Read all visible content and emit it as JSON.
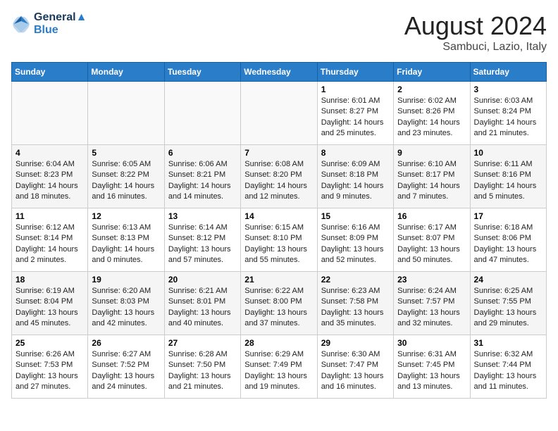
{
  "header": {
    "logo_line1": "General",
    "logo_line2": "Blue",
    "month": "August 2024",
    "location": "Sambuci, Lazio, Italy"
  },
  "weekdays": [
    "Sunday",
    "Monday",
    "Tuesday",
    "Wednesday",
    "Thursday",
    "Friday",
    "Saturday"
  ],
  "weeks": [
    [
      {
        "day": "",
        "info": ""
      },
      {
        "day": "",
        "info": ""
      },
      {
        "day": "",
        "info": ""
      },
      {
        "day": "",
        "info": ""
      },
      {
        "day": "1",
        "info": "Sunrise: 6:01 AM\nSunset: 8:27 PM\nDaylight: 14 hours\nand 25 minutes."
      },
      {
        "day": "2",
        "info": "Sunrise: 6:02 AM\nSunset: 8:26 PM\nDaylight: 14 hours\nand 23 minutes."
      },
      {
        "day": "3",
        "info": "Sunrise: 6:03 AM\nSunset: 8:24 PM\nDaylight: 14 hours\nand 21 minutes."
      }
    ],
    [
      {
        "day": "4",
        "info": "Sunrise: 6:04 AM\nSunset: 8:23 PM\nDaylight: 14 hours\nand 18 minutes."
      },
      {
        "day": "5",
        "info": "Sunrise: 6:05 AM\nSunset: 8:22 PM\nDaylight: 14 hours\nand 16 minutes."
      },
      {
        "day": "6",
        "info": "Sunrise: 6:06 AM\nSunset: 8:21 PM\nDaylight: 14 hours\nand 14 minutes."
      },
      {
        "day": "7",
        "info": "Sunrise: 6:08 AM\nSunset: 8:20 PM\nDaylight: 14 hours\nand 12 minutes."
      },
      {
        "day": "8",
        "info": "Sunrise: 6:09 AM\nSunset: 8:18 PM\nDaylight: 14 hours\nand 9 minutes."
      },
      {
        "day": "9",
        "info": "Sunrise: 6:10 AM\nSunset: 8:17 PM\nDaylight: 14 hours\nand 7 minutes."
      },
      {
        "day": "10",
        "info": "Sunrise: 6:11 AM\nSunset: 8:16 PM\nDaylight: 14 hours\nand 5 minutes."
      }
    ],
    [
      {
        "day": "11",
        "info": "Sunrise: 6:12 AM\nSunset: 8:14 PM\nDaylight: 14 hours\nand 2 minutes."
      },
      {
        "day": "12",
        "info": "Sunrise: 6:13 AM\nSunset: 8:13 PM\nDaylight: 14 hours\nand 0 minutes."
      },
      {
        "day": "13",
        "info": "Sunrise: 6:14 AM\nSunset: 8:12 PM\nDaylight: 13 hours\nand 57 minutes."
      },
      {
        "day": "14",
        "info": "Sunrise: 6:15 AM\nSunset: 8:10 PM\nDaylight: 13 hours\nand 55 minutes."
      },
      {
        "day": "15",
        "info": "Sunrise: 6:16 AM\nSunset: 8:09 PM\nDaylight: 13 hours\nand 52 minutes."
      },
      {
        "day": "16",
        "info": "Sunrise: 6:17 AM\nSunset: 8:07 PM\nDaylight: 13 hours\nand 50 minutes."
      },
      {
        "day": "17",
        "info": "Sunrise: 6:18 AM\nSunset: 8:06 PM\nDaylight: 13 hours\nand 47 minutes."
      }
    ],
    [
      {
        "day": "18",
        "info": "Sunrise: 6:19 AM\nSunset: 8:04 PM\nDaylight: 13 hours\nand 45 minutes."
      },
      {
        "day": "19",
        "info": "Sunrise: 6:20 AM\nSunset: 8:03 PM\nDaylight: 13 hours\nand 42 minutes."
      },
      {
        "day": "20",
        "info": "Sunrise: 6:21 AM\nSunset: 8:01 PM\nDaylight: 13 hours\nand 40 minutes."
      },
      {
        "day": "21",
        "info": "Sunrise: 6:22 AM\nSunset: 8:00 PM\nDaylight: 13 hours\nand 37 minutes."
      },
      {
        "day": "22",
        "info": "Sunrise: 6:23 AM\nSunset: 7:58 PM\nDaylight: 13 hours\nand 35 minutes."
      },
      {
        "day": "23",
        "info": "Sunrise: 6:24 AM\nSunset: 7:57 PM\nDaylight: 13 hours\nand 32 minutes."
      },
      {
        "day": "24",
        "info": "Sunrise: 6:25 AM\nSunset: 7:55 PM\nDaylight: 13 hours\nand 29 minutes."
      }
    ],
    [
      {
        "day": "25",
        "info": "Sunrise: 6:26 AM\nSunset: 7:53 PM\nDaylight: 13 hours\nand 27 minutes."
      },
      {
        "day": "26",
        "info": "Sunrise: 6:27 AM\nSunset: 7:52 PM\nDaylight: 13 hours\nand 24 minutes."
      },
      {
        "day": "27",
        "info": "Sunrise: 6:28 AM\nSunset: 7:50 PM\nDaylight: 13 hours\nand 21 minutes."
      },
      {
        "day": "28",
        "info": "Sunrise: 6:29 AM\nSunset: 7:49 PM\nDaylight: 13 hours\nand 19 minutes."
      },
      {
        "day": "29",
        "info": "Sunrise: 6:30 AM\nSunset: 7:47 PM\nDaylight: 13 hours\nand 16 minutes."
      },
      {
        "day": "30",
        "info": "Sunrise: 6:31 AM\nSunset: 7:45 PM\nDaylight: 13 hours\nand 13 minutes."
      },
      {
        "day": "31",
        "info": "Sunrise: 6:32 AM\nSunset: 7:44 PM\nDaylight: 13 hours\nand 11 minutes."
      }
    ]
  ]
}
